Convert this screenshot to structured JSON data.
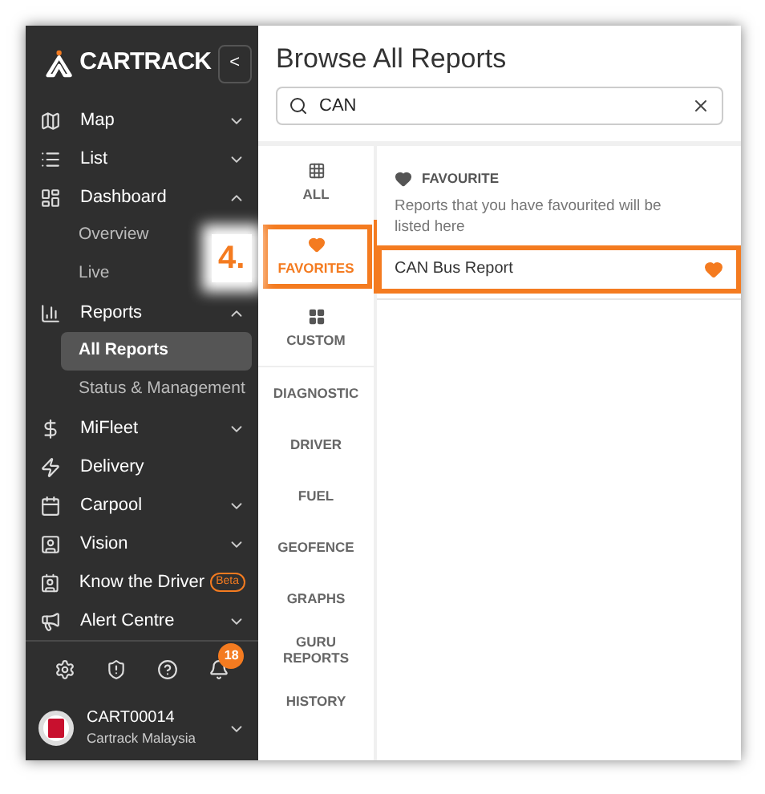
{
  "sidebar": {
    "logo": "CARTRACK",
    "collapse_button": "<",
    "items": [
      {
        "label": "Map",
        "kind": "menu",
        "expanded": false,
        "selected": false
      },
      {
        "label": "List",
        "kind": "menu",
        "expanded": false,
        "selected": false
      },
      {
        "label": "Dashboard",
        "kind": "menu",
        "expanded": true,
        "selected": false,
        "children": [
          {
            "label": "Overview",
            "selected": false
          },
          {
            "label": "Live",
            "selected": false
          }
        ]
      },
      {
        "label": "Reports",
        "kind": "menu",
        "expanded": true,
        "selected": false,
        "children": [
          {
            "label": "All Reports",
            "selected": true
          },
          {
            "label": "Status & Management",
            "selected": false
          }
        ]
      },
      {
        "label": "MiFleet",
        "kind": "menu",
        "expanded": false,
        "selected": false
      },
      {
        "label": "Delivery",
        "kind": "link",
        "selected": false
      },
      {
        "label": "Carpool",
        "kind": "menu",
        "expanded": false,
        "selected": false
      },
      {
        "label": "Vision",
        "kind": "menu",
        "expanded": false,
        "selected": false
      },
      {
        "label": "Know the Driver",
        "kind": "link",
        "selected": false,
        "badge": "Beta"
      },
      {
        "label": "Alert Centre",
        "kind": "menu",
        "expanded": false,
        "selected": false
      }
    ],
    "notification_count": "18",
    "user": {
      "name": "CART00014",
      "company": "Cartrack Malaysia"
    }
  },
  "main": {
    "title": "Browse All Reports",
    "search": {
      "value": "CAN"
    },
    "categories": [
      {
        "label": "ALL",
        "kind": "icon",
        "selected": false
      },
      {
        "label": "FAVORITES",
        "kind": "icon",
        "selected": true
      },
      {
        "label": "CUSTOM",
        "kind": "icon",
        "selected": false
      },
      {
        "label": "DIAGNOSTIC",
        "kind": "text",
        "selected": false
      },
      {
        "label": "DRIVER",
        "kind": "text",
        "selected": false
      },
      {
        "label": "FUEL",
        "kind": "text",
        "selected": false
      },
      {
        "label": "GEOFENCE",
        "kind": "text",
        "selected": false
      },
      {
        "label": "GRAPHS",
        "kind": "text",
        "selected": false
      },
      {
        "label": "GURU REPORTS",
        "kind": "text",
        "selected": false
      },
      {
        "label": "HISTORY",
        "kind": "text",
        "selected": false
      }
    ],
    "section": {
      "title": "FAVOURITE",
      "description": "Reports that you have favourited will be listed here"
    },
    "reports": [
      {
        "name": "CAN Bus Report",
        "favourite": true
      }
    ]
  },
  "annotation": {
    "step": "4."
  }
}
